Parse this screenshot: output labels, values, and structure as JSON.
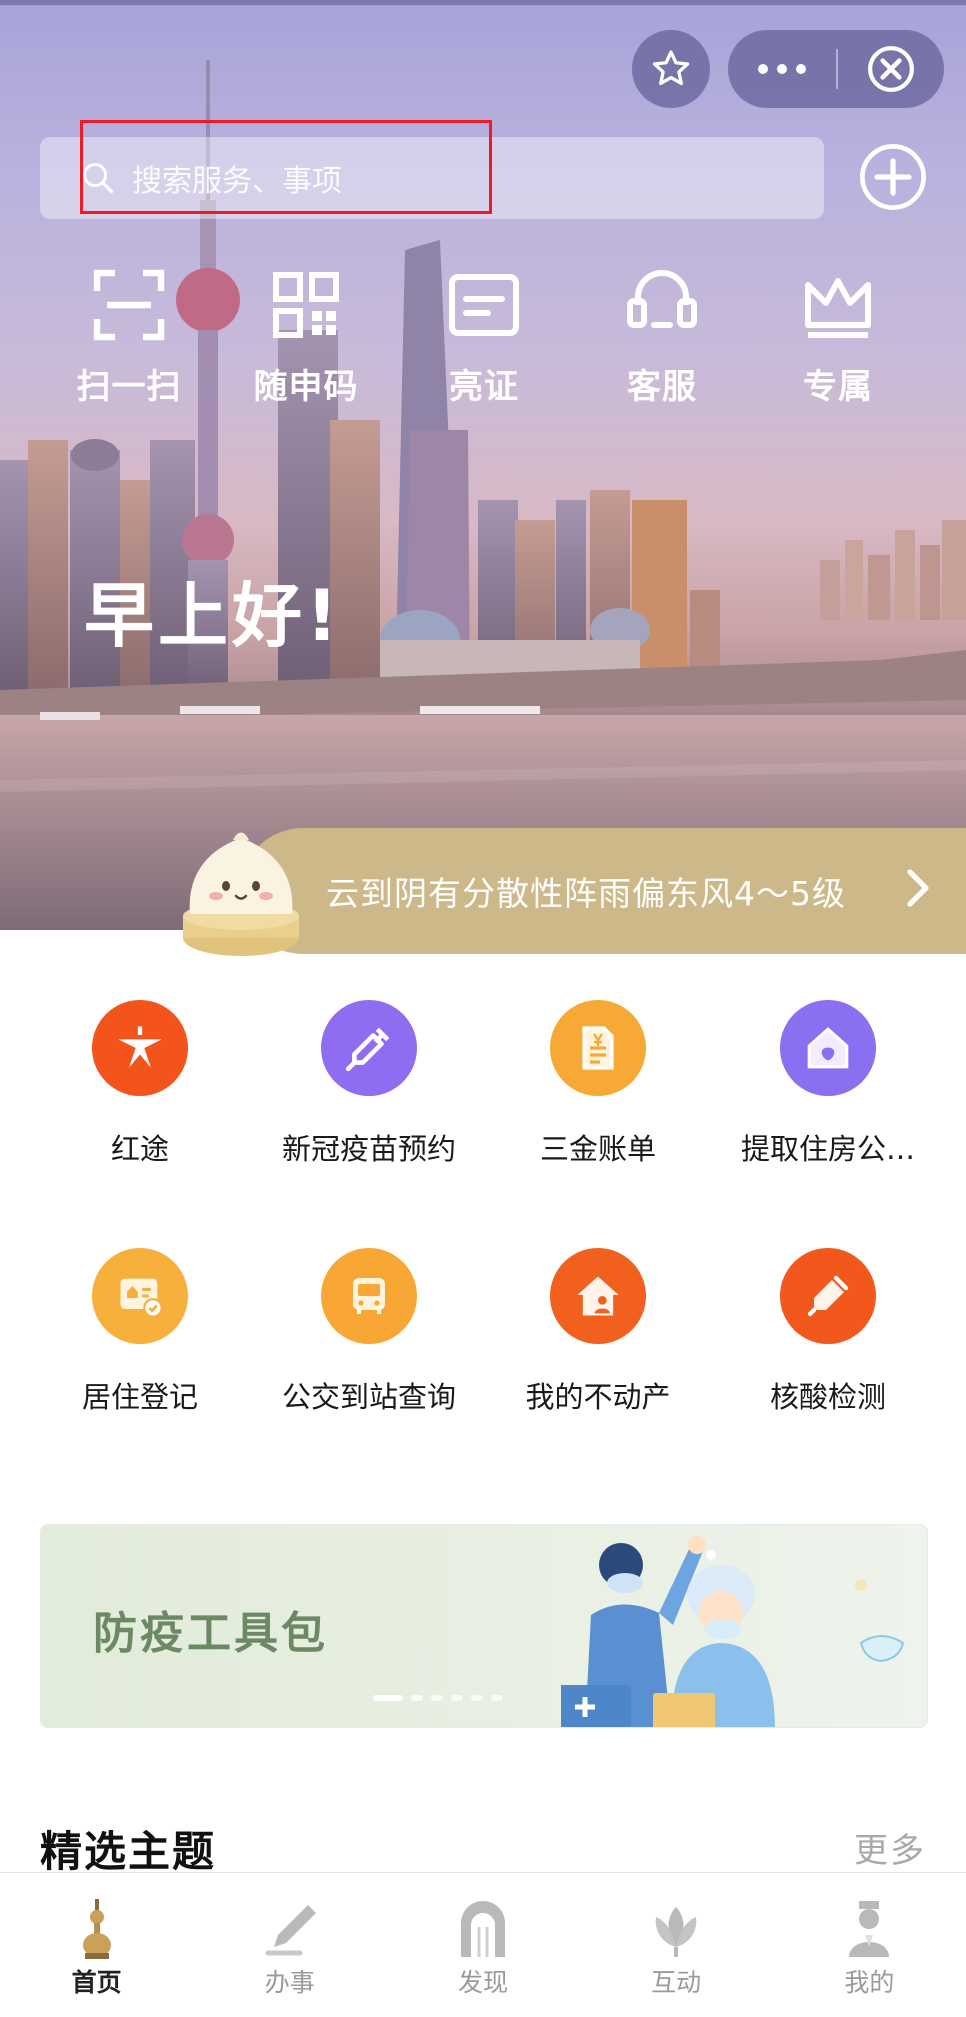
{
  "header": {
    "search_placeholder": "搜索服务、事项",
    "quick_actions": [
      {
        "label": "扫一扫",
        "icon": "scan-icon"
      },
      {
        "label": "随申码",
        "icon": "qr-code-icon"
      },
      {
        "label": "亮证",
        "icon": "id-card-icon"
      },
      {
        "label": "客服",
        "icon": "headset-icon"
      },
      {
        "label": "专属",
        "icon": "crown-icon"
      }
    ],
    "greeting": "早上好!",
    "weather": "云到阴有分散性阵雨偏东风4～5级",
    "capsule": {
      "star": "star-icon",
      "more": "more-icon",
      "close": "close-icon"
    }
  },
  "services": [
    {
      "label": "红途",
      "icon": "star-route-icon",
      "color": "#f2541c"
    },
    {
      "label": "新冠疫苗预约",
      "icon": "syringe-icon",
      "color": "#8f6cf0"
    },
    {
      "label": "三金账单",
      "icon": "bill-icon",
      "color": "#f7a936"
    },
    {
      "label": "提取住房公…",
      "icon": "house-fund-icon",
      "color": "#8a6ff0"
    },
    {
      "label": "居住登记",
      "icon": "residence-card-icon",
      "color": "#f7b03c"
    },
    {
      "label": "公交到站查询",
      "icon": "bus-icon",
      "color": "#f8a735"
    },
    {
      "label": "我的不动产",
      "icon": "property-house-icon",
      "color": "#f2601e"
    },
    {
      "label": "核酸检测",
      "icon": "swab-test-icon",
      "color": "#f2581c"
    }
  ],
  "banner": {
    "title": "防疫工具包",
    "slides": 6,
    "active_slide": 1
  },
  "section": {
    "title": "精选主题",
    "more": "更多"
  },
  "tabbar": [
    {
      "label": "首页",
      "icon": "tower-icon",
      "active": true
    },
    {
      "label": "办事",
      "icon": "pen-icon",
      "active": false
    },
    {
      "label": "发现",
      "icon": "arch-icon",
      "active": false
    },
    {
      "label": "互动",
      "icon": "magnolia-icon",
      "active": false
    },
    {
      "label": "我的",
      "icon": "person-icon",
      "active": false
    }
  ],
  "colors": {
    "accent_weather": "#cdb88a",
    "highlight": "#ee1b24",
    "tab_active": "#222222"
  }
}
